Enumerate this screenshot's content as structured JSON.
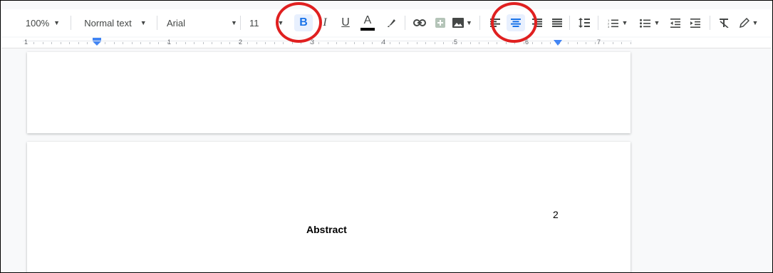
{
  "toolbar": {
    "zoom": "100%",
    "style": "Normal text",
    "font": "Arial",
    "font_size": "11",
    "bold_label": "B",
    "italic_label": "I",
    "underline_label": "U",
    "text_color_label": "A"
  },
  "ruler": {
    "numbers": [
      "1",
      "1",
      "2",
      "3",
      "4",
      "5",
      "6",
      "7"
    ]
  },
  "document": {
    "page_number": "2",
    "heading": "Abstract"
  },
  "colors": {
    "accent": "#1a73e8",
    "highlight_circle": "#e02020"
  },
  "annotations": [
    "bold-button-highlight",
    "center-align-highlight"
  ]
}
